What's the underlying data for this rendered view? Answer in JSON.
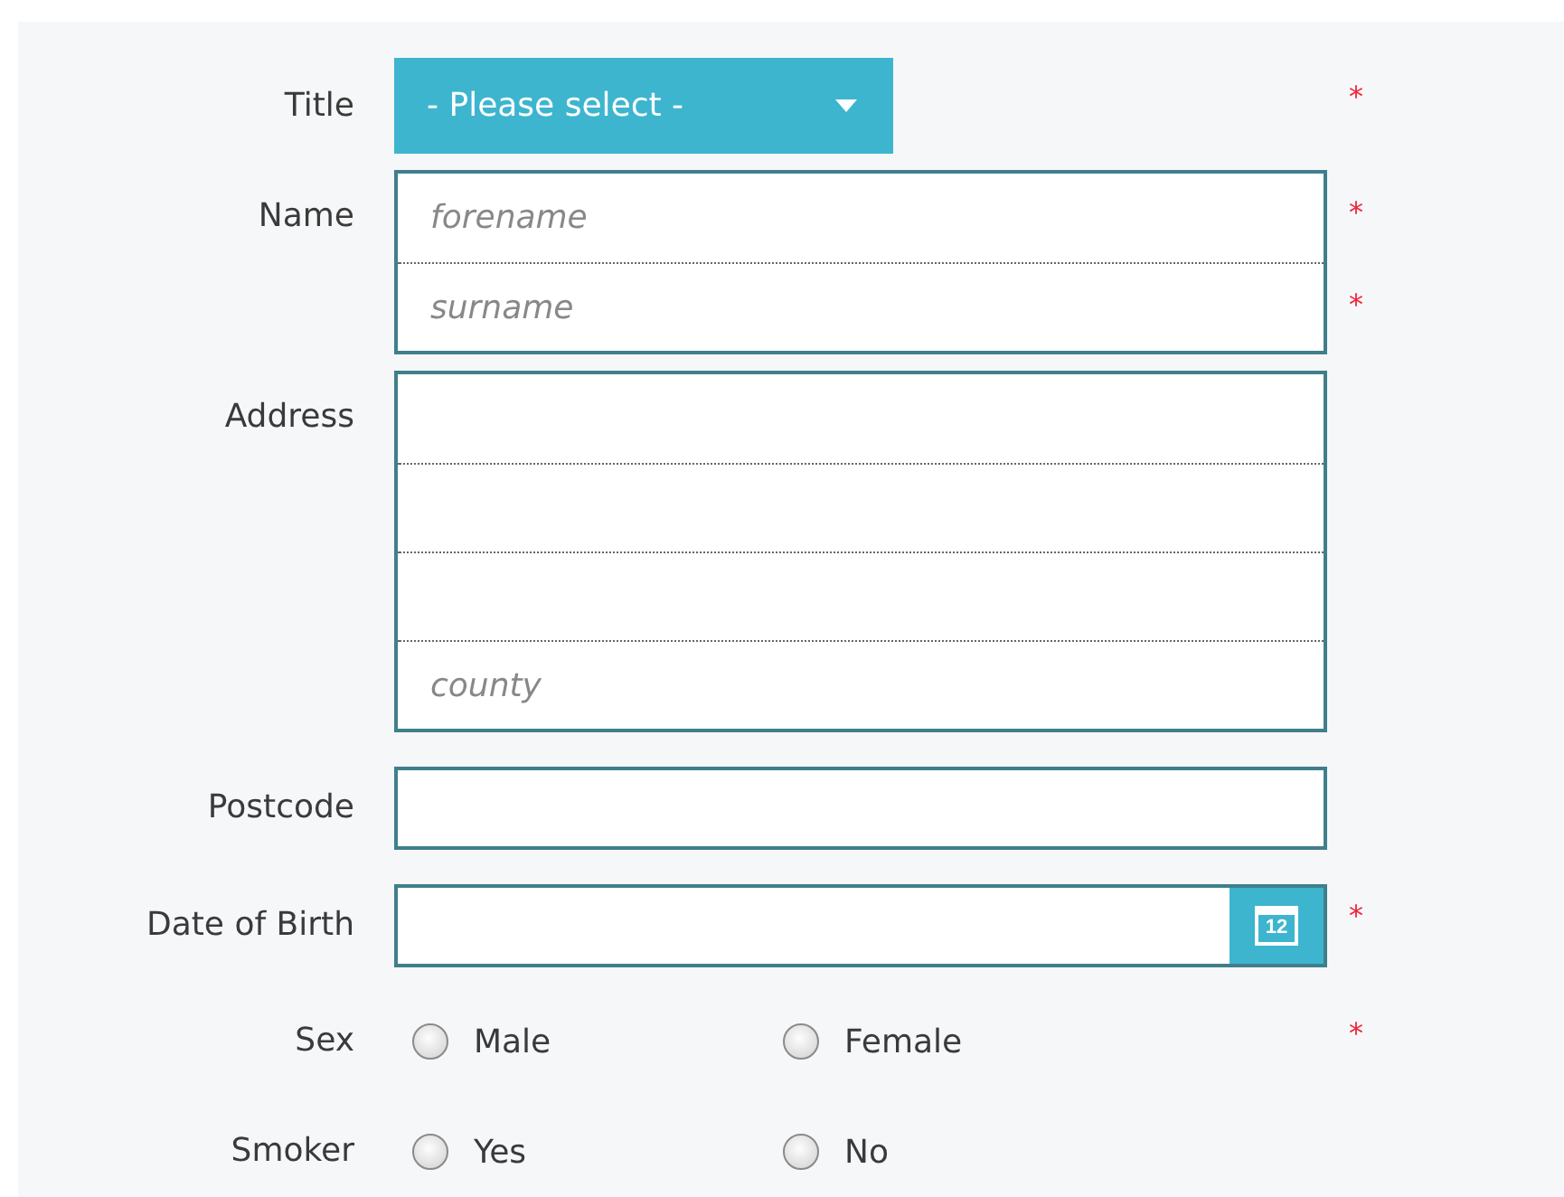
{
  "fields": [
    {
      "kind": "select",
      "label": "Title",
      "value": "- Please select -",
      "required_mark": "*"
    },
    {
      "kind": "multiline",
      "label": "Name",
      "lines": [
        {
          "kind": "input",
          "placeholder": "forename",
          "required_mark": "*"
        },
        {
          "kind": "input",
          "placeholder": "surname",
          "required_mark": "*"
        }
      ]
    },
    {
      "kind": "multiline",
      "label": "Address",
      "lines": [
        {
          "kind": "blank"
        },
        {
          "kind": "blank"
        },
        {
          "kind": "blank"
        },
        {
          "kind": "input",
          "placeholder": "county"
        }
      ]
    },
    {
      "kind": "text",
      "label": "Postcode"
    },
    {
      "kind": "date",
      "label": "Date of Birth",
      "calendar_day": "12",
      "required_mark": "*"
    },
    {
      "kind": "radio",
      "label": "Sex",
      "required_mark": "*",
      "options": [
        {
          "label": "Male",
          "selected": false
        },
        {
          "label": "Female",
          "selected": false
        }
      ]
    },
    {
      "kind": "radio",
      "label": "Smoker",
      "options": [
        {
          "label": "Yes",
          "selected": false
        },
        {
          "label": "No",
          "selected": false
        }
      ]
    }
  ]
}
